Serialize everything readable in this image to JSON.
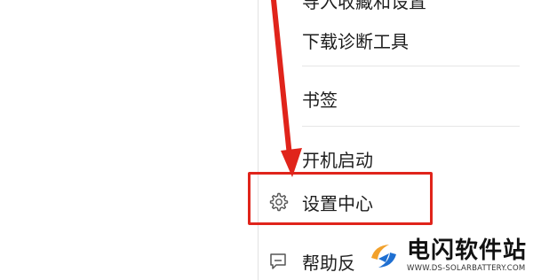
{
  "menu": {
    "clipped_top_item": "导入收藏和设置",
    "items": [
      {
        "label": "下载诊断工具"
      },
      {
        "label": "书签"
      },
      {
        "label": "开机启动"
      },
      {
        "label": "设置中心",
        "icon": "gear-icon",
        "highlighted": true
      },
      {
        "label": "帮助反",
        "icon": "feedback-icon"
      }
    ]
  },
  "annotation": {
    "arrow_color": "#e0241b",
    "box_color": "#e0241b"
  },
  "watermark": {
    "title": "电闪软件站",
    "subtitle": "WWW.DS-SOLARBATTERY.COM"
  }
}
